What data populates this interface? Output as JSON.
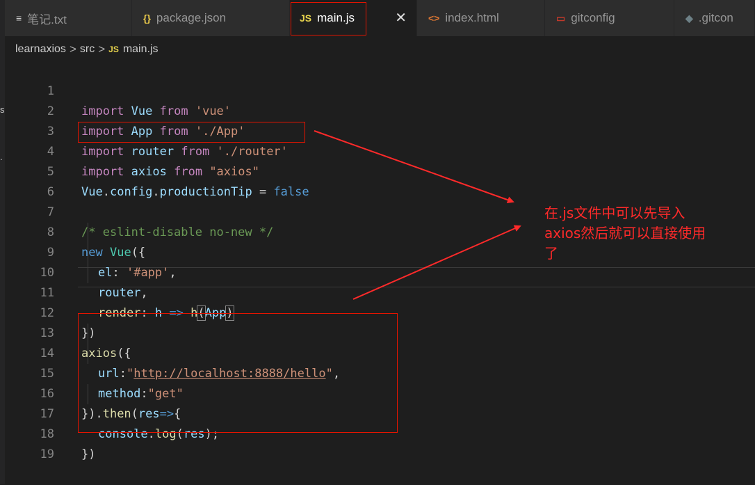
{
  "left_strip": {
    "frag1": "s",
    "frag2": "."
  },
  "tabs": [
    {
      "icon": "≡",
      "label": "笔记.txt",
      "icon_color": "#cccccc"
    },
    {
      "icon": "{}",
      "label": "package.json",
      "icon_color": "#e8c84a"
    },
    {
      "icon": "JS",
      "label": "main.js",
      "icon_color": "#e8d44d",
      "close": "✕"
    },
    {
      "icon": "<>",
      "label": "index.html",
      "icon_color": "#e37933"
    },
    {
      "icon": "▭",
      "label": "gitconfig",
      "icon_color": "#c0392b"
    },
    {
      "icon": "◆",
      "label": ".gitcon",
      "icon_color": "#6d8086"
    }
  ],
  "breadcrumb": {
    "root": "learnaxios",
    "sep": ">",
    "folder": "src",
    "file_icon": "JS",
    "file": "main.js"
  },
  "line_numbers": [
    "1",
    "2",
    "3",
    "4",
    "5",
    "6",
    "7",
    "8",
    "9",
    "10",
    "11",
    "12",
    "13",
    "14",
    "15",
    "16",
    "17",
    "18",
    "19"
  ],
  "code": {
    "l1": {
      "kw": "import",
      "a": "Vue",
      "from": "from",
      "s": "'vue'"
    },
    "l2": {
      "kw": "import",
      "a": "App",
      "from": "from",
      "s": "'./App'"
    },
    "l3": {
      "kw": "import",
      "a": "router",
      "from": "from",
      "s": "'./router'"
    },
    "l4": {
      "kw": "import",
      "a": "axios",
      "from": "from",
      "s": "\"axios\""
    },
    "l5": {
      "obj": "Vue",
      "d1": ".",
      "p1": "config",
      "d2": ".",
      "p2": "productionTip",
      "eq": " = ",
      "val": "false"
    },
    "l7": {
      "c": "/* eslint-disable no-new */"
    },
    "l8": {
      "kw": "new",
      "cls": "Vue",
      "p": "({"
    },
    "l9": {
      "k": "el",
      "colon": ": ",
      "s": "'#app'",
      "comma": ","
    },
    "l10": {
      "k": "router",
      "comma": ","
    },
    "l11": {
      "k": "render",
      "colon": ": ",
      "arg": "h",
      "arrow": " => ",
      "fn": "h",
      "open": "(",
      "a2": "App",
      "close": ")"
    },
    "l12": {
      "t": "})"
    },
    "l13": {
      "fn": "axios",
      "t": "({"
    },
    "l14": {
      "k": "url",
      "colon": ":",
      "q1": "\"",
      "u": "http://localhost:8888/hello",
      "q2": "\"",
      "comma": ","
    },
    "l15": {
      "k": "method",
      "colon": ":",
      "s": "\"get\""
    },
    "l16": {
      "t1": "}).",
      "fn": "then",
      "t2": "(",
      "arg": "res",
      "arrow": "=>",
      "t3": "{"
    },
    "l17": {
      "obj": "console",
      "dot": ".",
      "fn": "log",
      "t1": "(",
      "arg": "res",
      "t2": ");"
    },
    "l18": {
      "t": "})"
    }
  },
  "annotation": {
    "line1": "在.js文件中可以先导入",
    "line2": "axios然后就可以直接使用",
    "line3": "了"
  },
  "colors": {
    "annotation": "#ff2a2a",
    "highlight_box": "#e51400",
    "background": "#1e1e1e"
  }
}
